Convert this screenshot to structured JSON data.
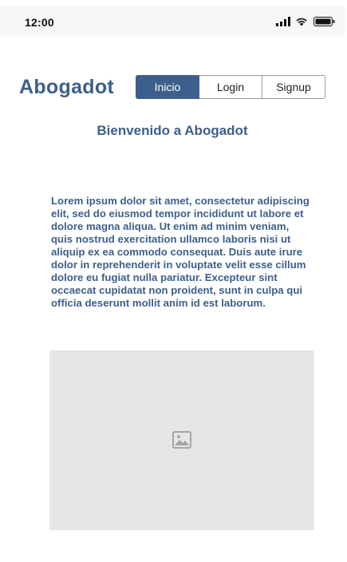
{
  "status_bar": {
    "time": "12:00",
    "icons": [
      "signal-icon",
      "wifi-icon",
      "battery-icon"
    ]
  },
  "header": {
    "brand": "Abogadot"
  },
  "nav": {
    "items": [
      {
        "label": "Inicio",
        "active": true
      },
      {
        "label": "Login",
        "active": false
      },
      {
        "label": "Signup",
        "active": false
      }
    ]
  },
  "main": {
    "heading": "Bienvenido a Abogadot",
    "body": "Lorem ipsum dolor sit amet, consectetur adipiscing elit, sed do eiusmod tempor incididunt ut labore et dolore magna aliqua. Ut enim ad minim veniam, quis nostrud exercitation ullamco laboris nisi ut aliquip ex ea commodo consequat. Duis aute irure dolor in reprehenderit in voluptate velit esse cillum dolore eu fugiat nulla pariatur. Excepteur sint occaecat cupidatat non proident, sunt in culpa qui officia deserunt mollit anim id est laborum.",
    "image_icon": "image-icon"
  },
  "colors": {
    "accent": "#3d5f8b",
    "placeholder_bg": "#e6e6e6",
    "status_bar_bg": "#f7f7f7"
  }
}
